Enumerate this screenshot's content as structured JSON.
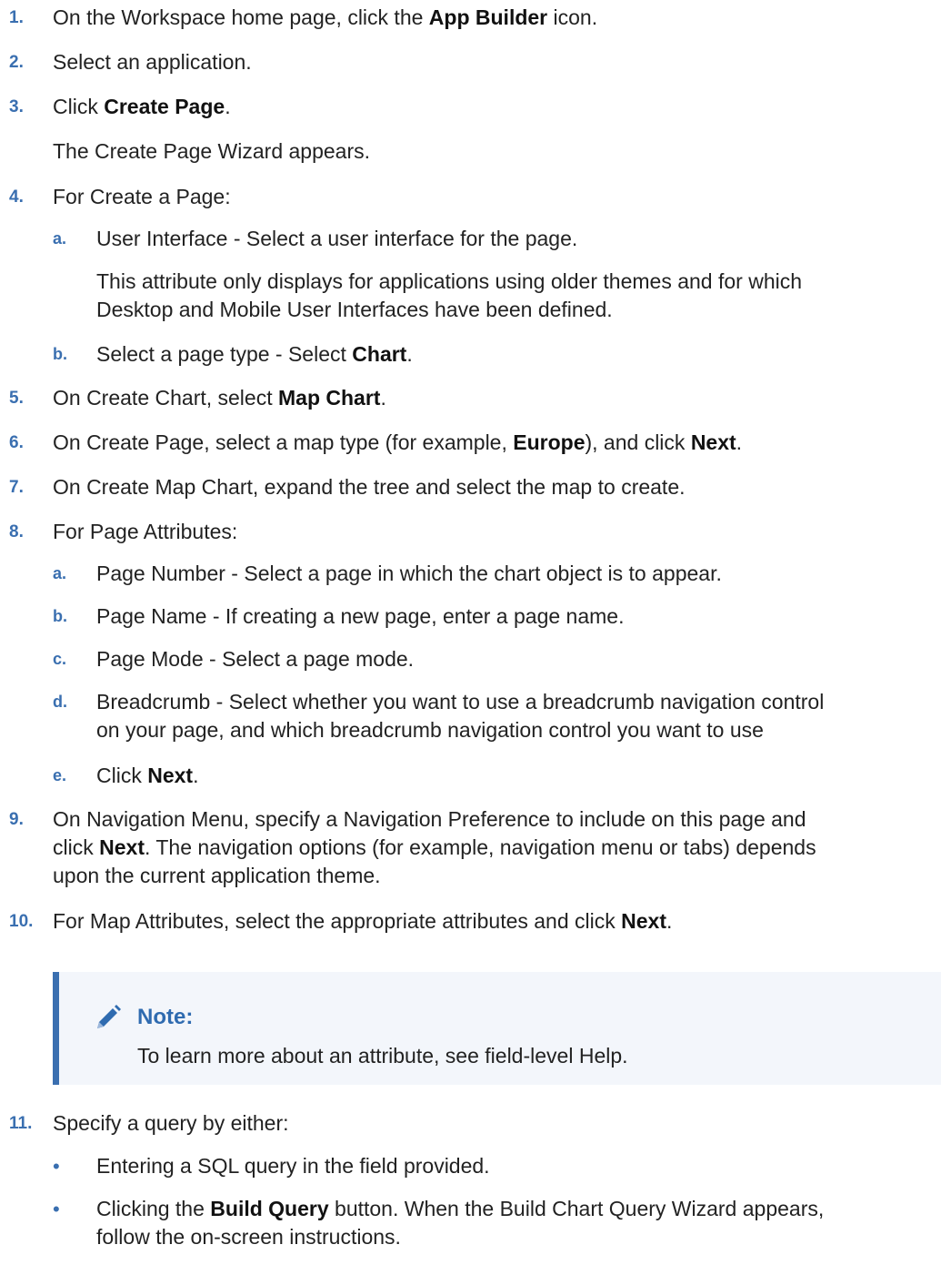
{
  "steps": [
    {
      "num": "1.",
      "pre": "On the Workspace home page, click the ",
      "bold": "App Builder",
      "post": " icon."
    },
    {
      "num": "2.",
      "text": "Select an application."
    },
    {
      "num": "3.",
      "pre": "Click ",
      "bold": "Create Page",
      "post": "."
    },
    {
      "cont": "The Create Page Wizard appears."
    },
    {
      "num": "4.",
      "text": "For Create a Page:"
    },
    {
      "num": "5.",
      "pre": "On Create Chart, select ",
      "bold": "Map Chart",
      "post": "."
    },
    {
      "num": "6.",
      "pre": "On Create Page, select a map type (for example, ",
      "bold": "Europe",
      "mid": "), and click ",
      "bold2": "Next",
      "post": "."
    },
    {
      "num": "7.",
      "text": "On Create Map Chart, expand the tree and select the map to create."
    },
    {
      "num": "8.",
      "text": "For Page Attributes:"
    },
    {
      "num": "9.",
      "line1": "On Navigation Menu, specify a Navigation Preference to include on this page and",
      "pre": "click ",
      "bold": "Next",
      "post": ". The navigation options (for example, navigation menu or tabs) depends",
      "line3": "upon the current application theme."
    },
    {
      "num": "10.",
      "pre": "For Map Attributes, select the appropriate attributes and click ",
      "bold": "Next",
      "post": "."
    },
    {
      "num": "11.",
      "text": "Specify a query by either:"
    }
  ],
  "step4_subs": [
    {
      "num": "a.",
      "text": "User Interface - Select a user interface for the page.",
      "detail1": "This attribute only displays for applications using older themes and for which",
      "detail2": "Desktop and Mobile User Interfaces have been defined."
    },
    {
      "num": "b.",
      "pre": "Select a page type - Select ",
      "bold": "Chart",
      "post": "."
    }
  ],
  "step8_subs": [
    {
      "num": "a.",
      "text": "Page Number - Select a page in which the chart object is to appear."
    },
    {
      "num": "b.",
      "text": "Page Name - If creating a new page, enter a page name."
    },
    {
      "num": "c.",
      "text": "Page Mode - Select a page mode."
    },
    {
      "num": "d.",
      "line1": "Breadcrumb - Select whether you want to use a breadcrumb navigation control",
      "line2": "on your page, and which breadcrumb navigation control you want to use"
    },
    {
      "num": "e.",
      "pre": "Click ",
      "bold": "Next",
      "post": "."
    }
  ],
  "note": {
    "title": "Note:",
    "text": "To learn more about an attribute, see field-level Help.",
    "icon": "pencil-icon"
  },
  "step11_bullets": [
    {
      "text": "Entering a SQL query in the field provided."
    },
    {
      "pre": "Clicking the ",
      "bold": "Build Query",
      "post": " button. When the Build Chart Query Wizard appears,",
      "line2": "follow the on-screen instructions."
    }
  ],
  "colors": {
    "accent": "#3a6fb0",
    "note_bg": "#f3f6fb"
  }
}
